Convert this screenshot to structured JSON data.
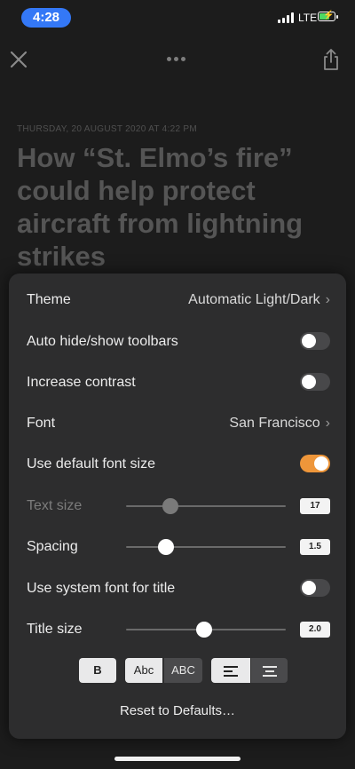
{
  "status_bar": {
    "time": "4:28",
    "network": "LTE",
    "signal_bars": 4,
    "battery_level": 0.6,
    "charging": true
  },
  "toolbar": {
    "icons": [
      "close-icon",
      "more-icon",
      "share-icon"
    ]
  },
  "article": {
    "dateline": "THURSDAY, 20 AUGUST 2020 AT 4:22 PM",
    "headline": "How “St. Elmo’s fire” could help protect aircraft from lightning strikes"
  },
  "settings": {
    "theme": {
      "label": "Theme",
      "value": "Automatic Light/Dark"
    },
    "auto_hide_toolbars": {
      "label": "Auto hide/show toolbars",
      "on": false
    },
    "increase_contrast": {
      "label": "Increase contrast",
      "on": false
    },
    "font": {
      "label": "Font",
      "value": "San Francisco"
    },
    "use_default_font_size": {
      "label": "Use default font size",
      "on": true
    },
    "text_size": {
      "label": "Text size",
      "value": "17",
      "level": 0.25,
      "enabled": false
    },
    "spacing": {
      "label": "Spacing",
      "value": "1.5",
      "level": 0.22
    },
    "system_font_title": {
      "label": "Use system font for title",
      "on": false
    },
    "title_size": {
      "label": "Title size",
      "value": "2.0",
      "level": 0.49
    },
    "format_buttons": {
      "bold": "B",
      "title_case": "Abc",
      "upper_case": "ABC"
    },
    "align_icons": [
      "align-left-icon",
      "align-center-icon"
    ],
    "reset_label": "Reset to Defaults…"
  },
  "colors": {
    "accent": "#ee963a",
    "time_pill": "#3478f6",
    "panel": "#2d2d2e",
    "background": "#1c1c1c"
  }
}
